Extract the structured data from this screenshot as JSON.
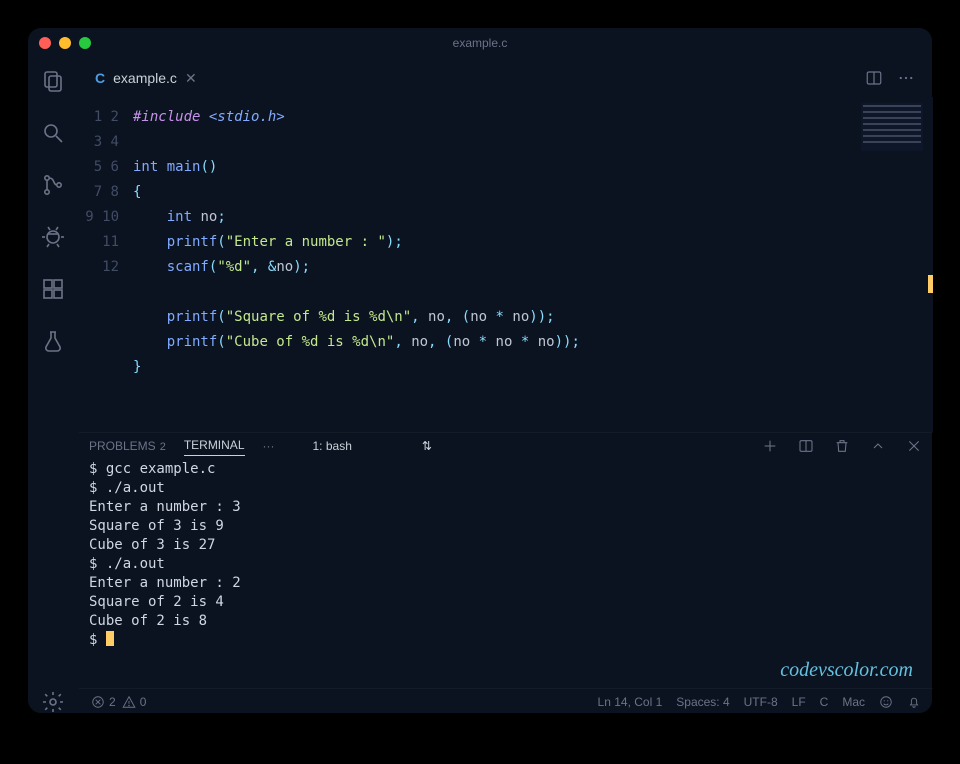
{
  "window": {
    "title": "example.c"
  },
  "tabs": [
    {
      "icon_letter": "C",
      "label": "example.c"
    }
  ],
  "editor": {
    "line_count": 12,
    "lines": [
      {
        "n": 1
      },
      {
        "n": 2
      },
      {
        "n": 3
      },
      {
        "n": 4
      },
      {
        "n": 5
      },
      {
        "n": 6
      },
      {
        "n": 7
      },
      {
        "n": 8
      },
      {
        "n": 9
      },
      {
        "n": 10
      },
      {
        "n": 11
      },
      {
        "n": 12
      }
    ],
    "tokens": {
      "include": "#include",
      "include_path": "<stdio.h>",
      "int": "int",
      "main": "main",
      "lparen": "(",
      "rparen": ")",
      "lbrace": "{",
      "rbrace": "}",
      "no": "no",
      "semi": ";",
      "printf": "printf",
      "scanf": "scanf",
      "comma": ",",
      "amp": "&",
      "star": "*",
      "str_enter": "\"Enter a number : \"",
      "str_fmt_d": "\"%d\"",
      "str_sq": "\"Square of %d is %d\\n\"",
      "str_cu": "\"Cube of %d is %d\\n\""
    }
  },
  "panel": {
    "problems_label": "PROBLEMS",
    "problems_count": "2",
    "terminal_label": "TERMINAL",
    "kebab": "···",
    "select_label": "1: bash"
  },
  "terminal_lines": [
    "$ gcc example.c",
    "$ ./a.out",
    "Enter a number : 3",
    "Square of 3 is 9",
    "Cube of 3 is 27",
    "$ ./a.out",
    "Enter a number : 2",
    "Square of 2 is 4",
    "Cube of 2 is 8",
    "$ "
  ],
  "watermark": "codevscolor.com",
  "status": {
    "errors": "2",
    "warnings": "0",
    "ln_col": "Ln 14, Col 1",
    "spaces": "Spaces: 4",
    "encoding": "UTF-8",
    "eol": "LF",
    "lang": "C",
    "os": "Mac"
  }
}
